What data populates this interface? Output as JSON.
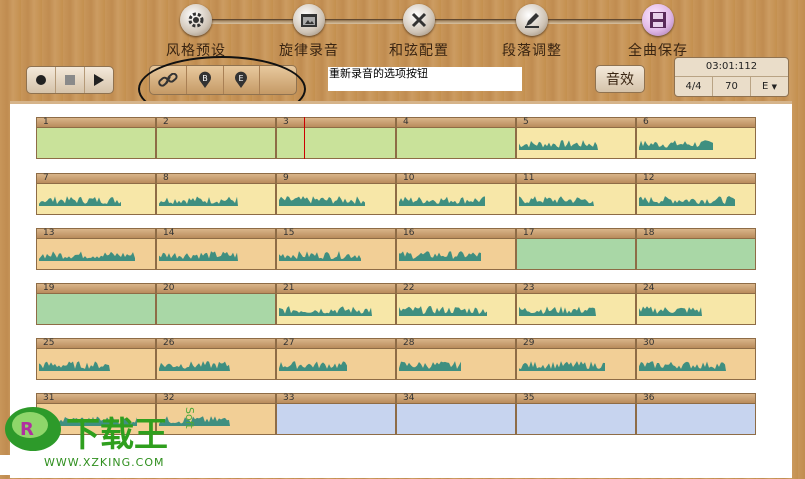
{
  "steps": [
    {
      "label": "风格预设",
      "icon": "gear-icon",
      "active": false
    },
    {
      "label": "旋律录音",
      "icon": "folder-icon",
      "active": false
    },
    {
      "label": "和弦配置",
      "icon": "tools-icon",
      "active": false
    },
    {
      "label": "段落调整",
      "icon": "edit-icon",
      "active": false
    },
    {
      "label": "全曲保存",
      "icon": "save-icon",
      "active": true
    }
  ],
  "note": "重新录音的选项按钮",
  "effects_label": "音效",
  "info": {
    "time": "03:01:112",
    "meter": "4/4",
    "tempo": "70",
    "key": "E",
    "key_arrow": "▼"
  },
  "logo": {
    "brand": "下载王",
    "url": "WWW.XZKING.COM",
    "side": "Soft"
  },
  "measures": [
    {
      "n": "1",
      "t": "green",
      "w": 0
    },
    {
      "n": "2",
      "t": "green",
      "w": 0
    },
    {
      "n": "3",
      "t": "green",
      "w": 0
    },
    {
      "n": "4",
      "t": "green",
      "w": 0
    },
    {
      "n": "5",
      "t": "yellow",
      "w": 1
    },
    {
      "n": "6",
      "t": "yellow",
      "w": 1
    },
    {
      "n": "7",
      "t": "yellow",
      "w": 1
    },
    {
      "n": "8",
      "t": "yellow",
      "w": 1
    },
    {
      "n": "9",
      "t": "yellow",
      "w": 1
    },
    {
      "n": "10",
      "t": "yellow",
      "w": 1
    },
    {
      "n": "11",
      "t": "yellow",
      "w": 1
    },
    {
      "n": "12",
      "t": "yellow",
      "w": 1
    },
    {
      "n": "13",
      "t": "orange",
      "w": 1
    },
    {
      "n": "14",
      "t": "orange",
      "w": 1
    },
    {
      "n": "15",
      "t": "orange",
      "w": 1
    },
    {
      "n": "16",
      "t": "orange",
      "w": 1
    },
    {
      "n": "17",
      "t": "gray",
      "w": 0
    },
    {
      "n": "18",
      "t": "gray",
      "w": 0
    },
    {
      "n": "19",
      "t": "gray",
      "w": 0
    },
    {
      "n": "20",
      "t": "gray",
      "w": 0
    },
    {
      "n": "21",
      "t": "yellow",
      "w": 1
    },
    {
      "n": "22",
      "t": "yellow",
      "w": 1
    },
    {
      "n": "23",
      "t": "yellow",
      "w": 1
    },
    {
      "n": "24",
      "t": "yellow",
      "w": 1
    },
    {
      "n": "25",
      "t": "orange",
      "w": 1
    },
    {
      "n": "26",
      "t": "orange",
      "w": 1
    },
    {
      "n": "27",
      "t": "orange",
      "w": 1
    },
    {
      "n": "28",
      "t": "orange",
      "w": 1
    },
    {
      "n": "29",
      "t": "orange",
      "w": 1
    },
    {
      "n": "30",
      "t": "orange",
      "w": 1
    },
    {
      "n": "31",
      "t": "orange",
      "w": 1
    },
    {
      "n": "32",
      "t": "orange",
      "w": 1
    },
    {
      "n": "33",
      "t": "blue",
      "w": 0
    },
    {
      "n": "34",
      "t": "blue",
      "w": 0
    },
    {
      "n": "35",
      "t": "blue",
      "w": 0
    },
    {
      "n": "36",
      "t": "blue",
      "w": 0
    }
  ]
}
